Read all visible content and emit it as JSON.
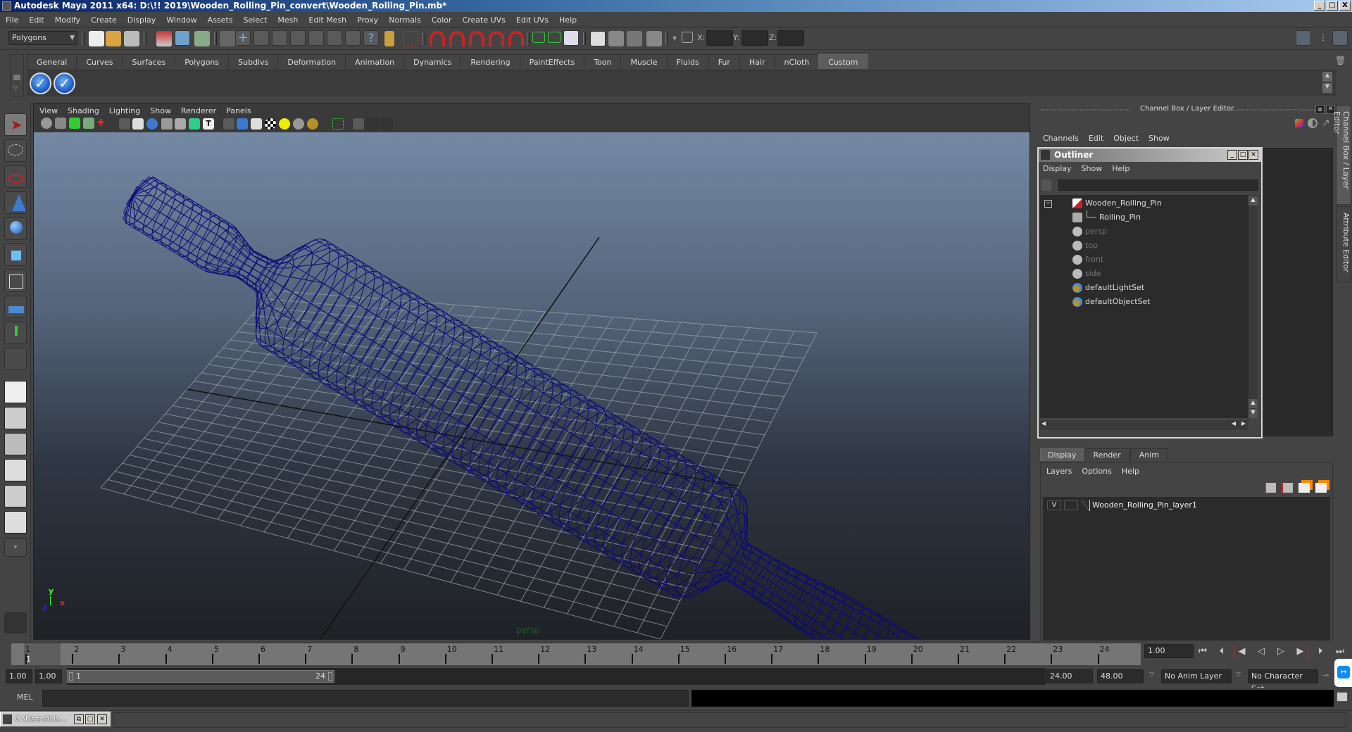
{
  "window": {
    "title": "Autodesk Maya 2011 x64: D:\\!! 2019\\Wooden_Rolling_Pin_convert\\Wooden_Rolling_Pin.mb*",
    "buttons": [
      "_",
      "□",
      "X"
    ]
  },
  "menubar": [
    "File",
    "Edit",
    "Modify",
    "Create",
    "Display",
    "Window",
    "Assets",
    "Select",
    "Mesh",
    "Edit Mesh",
    "Proxy",
    "Normals",
    "Color",
    "Create UVs",
    "Edit UVs",
    "Help"
  ],
  "statusline": {
    "menuset": "Polygons",
    "x_label": "X:",
    "y_label": "Y:",
    "z_label": "Z:",
    "x_value": "",
    "y_value": "",
    "z_value": ""
  },
  "shelf": {
    "tabs": [
      "General",
      "Curves",
      "Surfaces",
      "Polygons",
      "Subdivs",
      "Deformation",
      "Animation",
      "Dynamics",
      "Rendering",
      "PaintEffects",
      "Toon",
      "Muscle",
      "Fluids",
      "Fur",
      "Hair",
      "nCloth",
      "Custom"
    ],
    "active_tab": "Custom",
    "buttons": [
      "check-button-1",
      "check-button-2"
    ]
  },
  "viewport": {
    "menu": [
      "View",
      "Shading",
      "Lighting",
      "Show",
      "Renderer",
      "Panels"
    ],
    "camera_label": "persp",
    "axis": {
      "x": "x",
      "y": "y",
      "z": "z"
    },
    "wire_color": "#0b0b7a"
  },
  "channelbox": {
    "title": "Channel Box / Layer Editor",
    "menu": [
      "Channels",
      "Edit",
      "Object",
      "Show"
    ]
  },
  "outliner": {
    "title": "Outliner",
    "menu": [
      "Display",
      "Show",
      "Help"
    ],
    "items": [
      {
        "label": "Wooden_Rolling_Pin",
        "type": "transform",
        "dim": false
      },
      {
        "label": "Rolling_Pin",
        "type": "mesh",
        "dim": false
      },
      {
        "label": "persp",
        "type": "camera",
        "dim": true
      },
      {
        "label": "top",
        "type": "camera",
        "dim": true
      },
      {
        "label": "front",
        "type": "camera",
        "dim": true
      },
      {
        "label": "side",
        "type": "camera",
        "dim": true
      },
      {
        "label": "defaultLightSet",
        "type": "set",
        "dim": false
      },
      {
        "label": "defaultObjectSet",
        "type": "set",
        "dim": false
      }
    ]
  },
  "layereditor": {
    "tabs": [
      "Display",
      "Render",
      "Anim"
    ],
    "active_tab": "Display",
    "menu": [
      "Layers",
      "Options",
      "Help"
    ],
    "layers": [
      {
        "visible": "V",
        "name": "Wooden_Rolling_Pin_layer1"
      }
    ]
  },
  "sidetabs": [
    "Channel Box / Layer Editor",
    "Attribute Editor"
  ],
  "timeline": {
    "ticks": [
      "1",
      "2",
      "3",
      "4",
      "5",
      "6",
      "7",
      "8",
      "9",
      "10",
      "11",
      "12",
      "13",
      "14",
      "15",
      "16",
      "17",
      "18",
      "19",
      "20",
      "21",
      "22",
      "23",
      "24"
    ],
    "current_frame_marker": "1",
    "current_time": "1.00"
  },
  "range": {
    "start_time": "1.00",
    "playback_start": "1.00",
    "slider_start": "1",
    "slider_end": "24",
    "playback_end": "24.00",
    "end_time": "48.00",
    "anim_layer": "No Anim Layer",
    "character_set": "No Character Set"
  },
  "commandline": {
    "label": "MEL",
    "value": ""
  },
  "taskbar": {
    "minimized_window": "C:\\Users\\Us..."
  }
}
